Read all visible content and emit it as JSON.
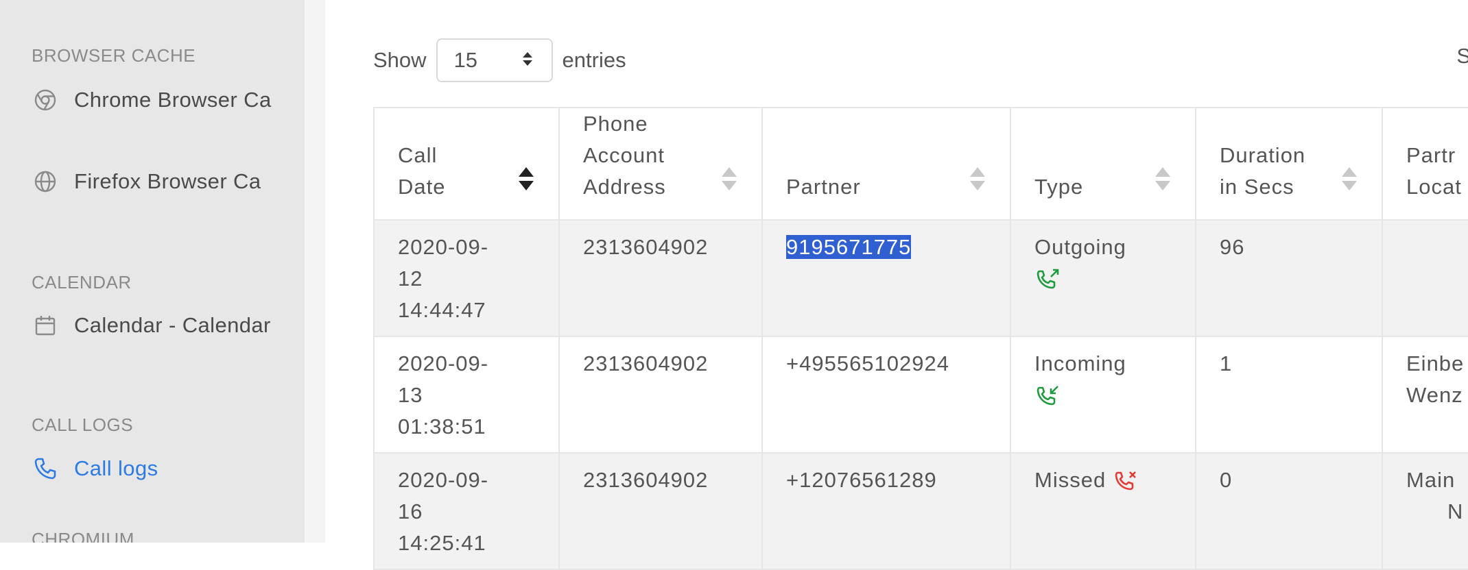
{
  "sidebar": {
    "sections": [
      {
        "title": "BROWSER CACHE",
        "items": [
          {
            "label": "Chrome Browser Ca",
            "icon": "chrome-icon"
          },
          {
            "label": "Firefox Browser Ca",
            "icon": "globe-icon"
          }
        ]
      },
      {
        "title": "CALENDAR",
        "items": [
          {
            "label": "Calendar - Calendar",
            "icon": "calendar-icon"
          }
        ]
      },
      {
        "title": "CALL LOGS",
        "items": [
          {
            "label": "Call logs",
            "icon": "phone-icon",
            "active": true
          }
        ]
      },
      {
        "title": "CHROMIUM",
        "items": []
      }
    ]
  },
  "controls": {
    "show_label": "Show",
    "page_size": "15",
    "entries_label": "entries",
    "search_label_fragment": "S"
  },
  "table": {
    "columns": [
      "Call Date",
      "Phone Account Address",
      "Partner",
      "Type",
      "Duration in Secs",
      "Partner Location"
    ],
    "column_headers_visible": [
      [
        "Call",
        "Date"
      ],
      [
        "Phone",
        "Account",
        "Address"
      ],
      [
        "Partner"
      ],
      [
        "Type"
      ],
      [
        "Duration",
        "in Secs"
      ],
      [
        "Partr",
        "Locat"
      ]
    ],
    "rows": [
      {
        "date": [
          "2020-09-",
          "12",
          "14:44:47"
        ],
        "account": "2313604902",
        "partner": "9195671775",
        "partner_selected": true,
        "type": "Outgoing",
        "type_icon": "outgoing-call-icon",
        "duration": "96",
        "location": [
          "",
          ""
        ]
      },
      {
        "date": [
          "2020-09-",
          "13",
          "01:38:51"
        ],
        "account": "2313604902",
        "partner": "+495565102924",
        "type": "Incoming",
        "type_icon": "incoming-call-icon",
        "duration": "1",
        "location": [
          "Einbe",
          "Wenz"
        ]
      },
      {
        "date": [
          "2020-09-",
          "16",
          "14:25:41"
        ],
        "account": "2313604902",
        "partner": "+12076561289",
        "type": "Missed",
        "type_icon": "missed-call-icon",
        "duration": "0",
        "location": [
          "Main",
          "N"
        ]
      }
    ]
  },
  "colors": {
    "accent": "#2c7be5",
    "selection": "#2f5fd0",
    "call_green": "#1e9b3c",
    "missed_red": "#e53935",
    "sidebar_bg": "#e7e7e7"
  }
}
